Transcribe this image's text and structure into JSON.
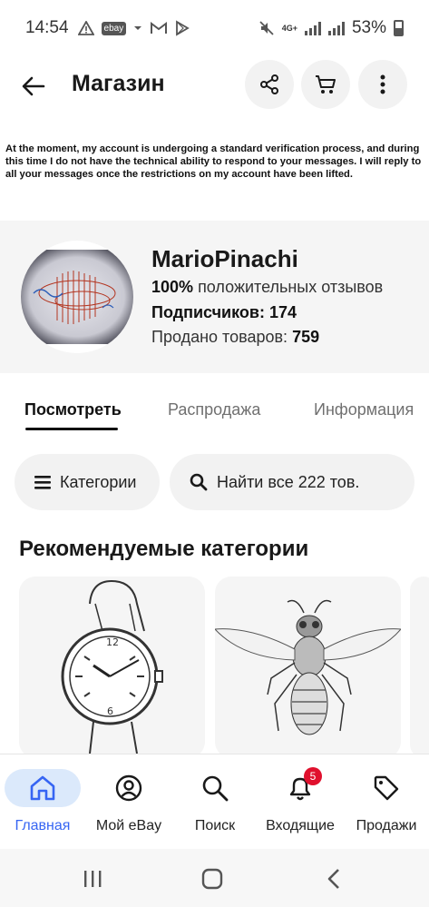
{
  "status_bar": {
    "time": "14:54",
    "ebay_chip": "ebay",
    "network": "4G+",
    "battery": "53%"
  },
  "header": {
    "title": "Магазин"
  },
  "notice": "At the moment, my account is undergoing a standard verification process, and during this time I do not have the technical ability to respond to your messages. I will reply to all your messages once the restrictions on my account have been lifted.",
  "seller": {
    "name": "MarioPinachi",
    "feedback_value": "100%",
    "feedback_label": "положительных отзывов",
    "followers_label": "Подписчиков:",
    "followers_value": "174",
    "sold_label": "Продано товаров:",
    "sold_value": "759"
  },
  "tabs": [
    {
      "label": "Посмотреть",
      "active": true
    },
    {
      "label": "Распродажа",
      "active": false
    },
    {
      "label": "Информация",
      "active": false
    }
  ],
  "filters": {
    "categories_label": "Категории",
    "search_label": "Найти все 222 тов."
  },
  "section": {
    "title": "Рекомендуемые категории"
  },
  "bottom_nav": [
    {
      "label": "Главная",
      "icon": "home-icon",
      "active": true
    },
    {
      "label": "Мой eBay",
      "icon": "profile-icon",
      "active": false
    },
    {
      "label": "Поиск",
      "icon": "search-icon",
      "active": false
    },
    {
      "label": "Входящие",
      "icon": "bell-icon",
      "active": false,
      "badge": "5"
    },
    {
      "label": "Продажи",
      "icon": "tag-icon",
      "active": false
    }
  ],
  "colors": {
    "accent": "#3665f3",
    "badge": "#e0102d",
    "active_nav_bg": "#dbe9fb"
  }
}
